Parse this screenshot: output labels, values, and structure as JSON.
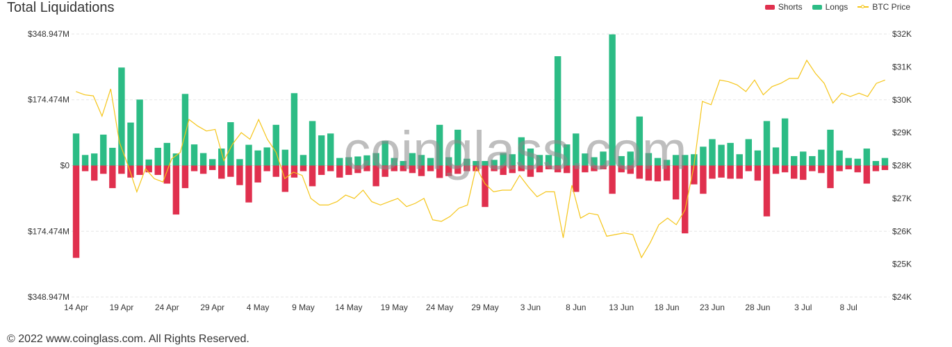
{
  "chart_title": "Total Liquidations",
  "footer": "© 2022 www.coinglass.com. All Rights Reserved.",
  "watermark": "coinglass.com",
  "colors": {
    "shorts": "#e0304e",
    "longs": "#2cbc85",
    "price": "#f5c518",
    "grid": "#e6e6e6"
  },
  "chart_data": {
    "type": "bar",
    "legend": [
      {
        "key": "shorts",
        "label": "Shorts",
        "kind": "bar"
      },
      {
        "key": "longs",
        "label": "Longs",
        "kind": "bar"
      },
      {
        "key": "price",
        "label": "BTC Price",
        "kind": "line"
      }
    ],
    "legend_position": "top-right",
    "x_tick_labels": [
      "14 Apr",
      "19 Apr",
      "24 Apr",
      "29 Apr",
      "4 May",
      "9 May",
      "14 May",
      "19 May",
      "24 May",
      "29 May",
      "3 Jun",
      "8 Jun",
      "13 Jun",
      "18 Jun",
      "23 Jun",
      "28 Jun",
      "3 Jul",
      "8 Jul"
    ],
    "x_tick_every": 5,
    "y_left": {
      "ticks": [
        348.947,
        174.474,
        0,
        -174.474,
        -348.947
      ],
      "tick_labels": [
        "$348.947M",
        "$174.474M",
        "$0",
        "$174.474M",
        "$348.947M"
      ],
      "range": [
        -348.947,
        348.947
      ],
      "unit": "M USD"
    },
    "y_right": {
      "ticks": [
        32000,
        31000,
        30000,
        29000,
        28000,
        27000,
        26000,
        25000,
        24000
      ],
      "tick_labels": [
        "$32K",
        "$31K",
        "$30K",
        "$29K",
        "$28K",
        "$27K",
        "$26K",
        "$25K",
        "$24K"
      ],
      "range": [
        24000,
        32000
      ]
    },
    "grid": true,
    "series": [
      {
        "name": "Longs",
        "values": [
          85,
          28,
          32,
          82,
          47,
          260,
          114,
          175,
          16,
          47,
          60,
          32,
          190,
          56,
          33,
          17,
          45,
          115,
          17,
          55,
          40,
          48,
          108,
          42,
          192,
          28,
          118,
          80,
          85,
          20,
          22,
          24,
          27,
          33,
          65,
          20,
          12,
          33,
          28,
          20,
          108,
          22,
          95,
          18,
          12,
          12,
          15,
          33,
          30,
          75,
          45,
          28,
          28,
          290,
          56,
          85,
          32,
          22,
          37,
          348,
          25,
          37,
          130,
          33,
          20,
          15,
          28,
          28,
          30,
          50,
          70,
          55,
          60,
          30,
          70,
          40,
          118,
          48,
          125,
          25,
          37,
          25,
          42,
          95,
          40,
          20,
          18,
          45,
          12,
          20
        ],
        "note": "in $M, positive"
      },
      {
        "name": "Shorts",
        "values": [
          -245,
          -15,
          -40,
          -22,
          -60,
          -22,
          -32,
          -25,
          -18,
          -25,
          -48,
          -130,
          -60,
          -15,
          -22,
          -12,
          -35,
          -30,
          -52,
          -98,
          -45,
          -15,
          -30,
          -70,
          -32,
          -15,
          -55,
          -25,
          -15,
          -32,
          -25,
          -20,
          -15,
          -55,
          -30,
          -15,
          -15,
          -20,
          -28,
          -15,
          -33,
          -28,
          -22,
          -15,
          -15,
          -110,
          -15,
          -25,
          -20,
          -15,
          -30,
          -18,
          -10,
          -18,
          -20,
          -70,
          -18,
          -15,
          -10,
          -75,
          -18,
          -22,
          -35,
          -40,
          -42,
          -40,
          -90,
          -180,
          -50,
          -75,
          -35,
          -32,
          -35,
          -35,
          -15,
          -40,
          -135,
          -22,
          -18,
          -35,
          -38,
          -15,
          -20,
          -60,
          -15,
          -10,
          -18,
          -48,
          -15,
          -12
        ],
        "note": "in $M, shown below zero"
      },
      {
        "name": "BTC Price",
        "axis": "right",
        "values": [
          30250,
          30150,
          30120,
          29500,
          30330,
          28700,
          28000,
          27200,
          27900,
          27600,
          27500,
          28200,
          28400,
          29400,
          29200,
          29050,
          29100,
          28150,
          28650,
          29000,
          28800,
          29400,
          28800,
          28400,
          27600,
          27800,
          27700,
          27000,
          26800,
          26800,
          26900,
          27100,
          27000,
          27250,
          26900,
          26800,
          26900,
          27000,
          26750,
          26850,
          27000,
          26350,
          26300,
          26450,
          26700,
          26800,
          27950,
          27450,
          27200,
          27250,
          27250,
          27700,
          27350,
          27050,
          27200,
          27200,
          25800,
          27400,
          26400,
          26550,
          26500,
          25850,
          25900,
          25950,
          25900,
          25200,
          25650,
          26200,
          26400,
          26200,
          26650,
          27950,
          29950,
          29850,
          30600,
          30550,
          30450,
          30250,
          30600,
          30150,
          30400,
          30500,
          30650,
          30650,
          31200,
          30800,
          30500,
          29900,
          30200,
          30100,
          30200,
          30100,
          30500,
          30600
        ]
      }
    ]
  }
}
